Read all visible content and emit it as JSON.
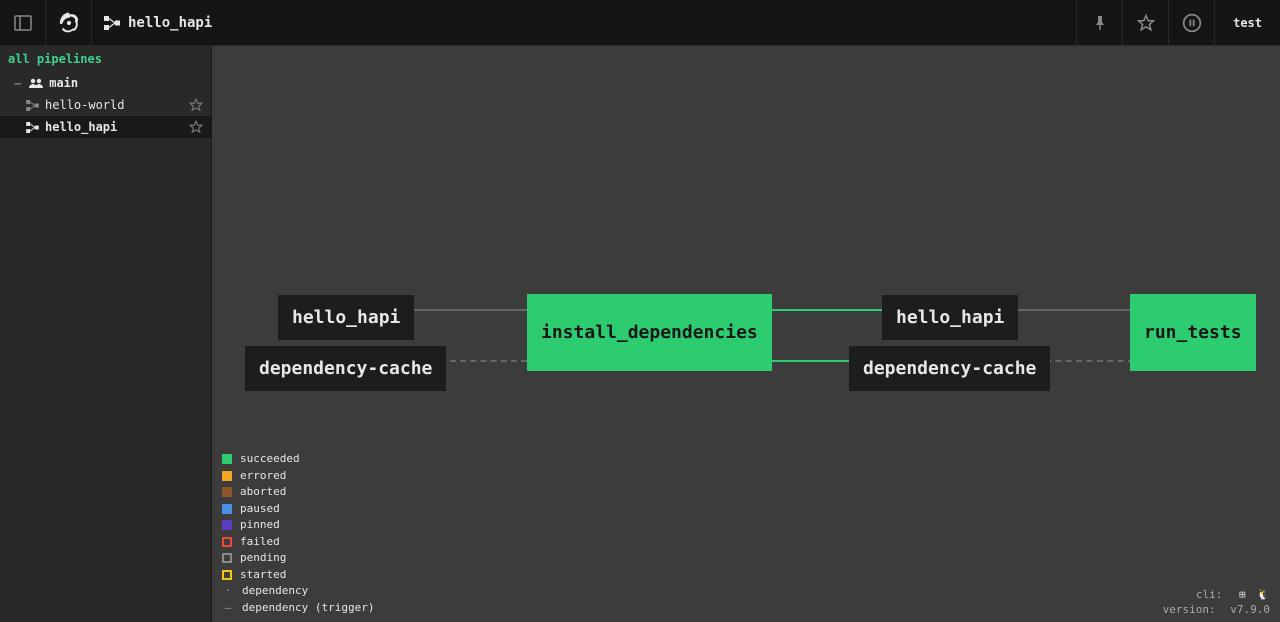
{
  "header": {
    "pipeline_name": "hello_hapi",
    "user": "test"
  },
  "sidebar": {
    "title": "all pipelines",
    "team": "main",
    "items": [
      {
        "label": "hello-world",
        "active": false
      },
      {
        "label": "hello_hapi",
        "active": true
      }
    ]
  },
  "graph": {
    "resources": [
      {
        "id": "r1",
        "label": "hello_hapi"
      },
      {
        "id": "r2",
        "label": "dependency-cache"
      },
      {
        "id": "r3",
        "label": "hello_hapi"
      },
      {
        "id": "r4",
        "label": "dependency-cache"
      }
    ],
    "jobs": [
      {
        "id": "j1",
        "label": "install_dependencies",
        "status": "succeeded"
      },
      {
        "id": "j2",
        "label": "run_tests",
        "status": "succeeded"
      }
    ]
  },
  "legend": {
    "items": [
      {
        "label": "succeeded",
        "color": "#2ecc71",
        "style": "solid"
      },
      {
        "label": "errored",
        "color": "#f5a623",
        "style": "solid"
      },
      {
        "label": "aborted",
        "color": "#8b572a",
        "style": "solid"
      },
      {
        "label": "paused",
        "color": "#4a90e2",
        "style": "solid"
      },
      {
        "label": "pinned",
        "color": "#5c3fbf",
        "style": "solid"
      },
      {
        "label": "failed",
        "color": "#ed4b35",
        "style": "outline"
      },
      {
        "label": "pending",
        "color": "#8a8a8a",
        "style": "outline"
      },
      {
        "label": "started",
        "color": "#f5c518",
        "style": "outline"
      }
    ],
    "dependency_label": "dependency",
    "dependency_trigger_label": "dependency (trigger)"
  },
  "footer": {
    "cli_label": "cli:",
    "version_label": "version:",
    "version": "v7.9.0"
  },
  "colors": {
    "accent": "#2ecc71"
  }
}
